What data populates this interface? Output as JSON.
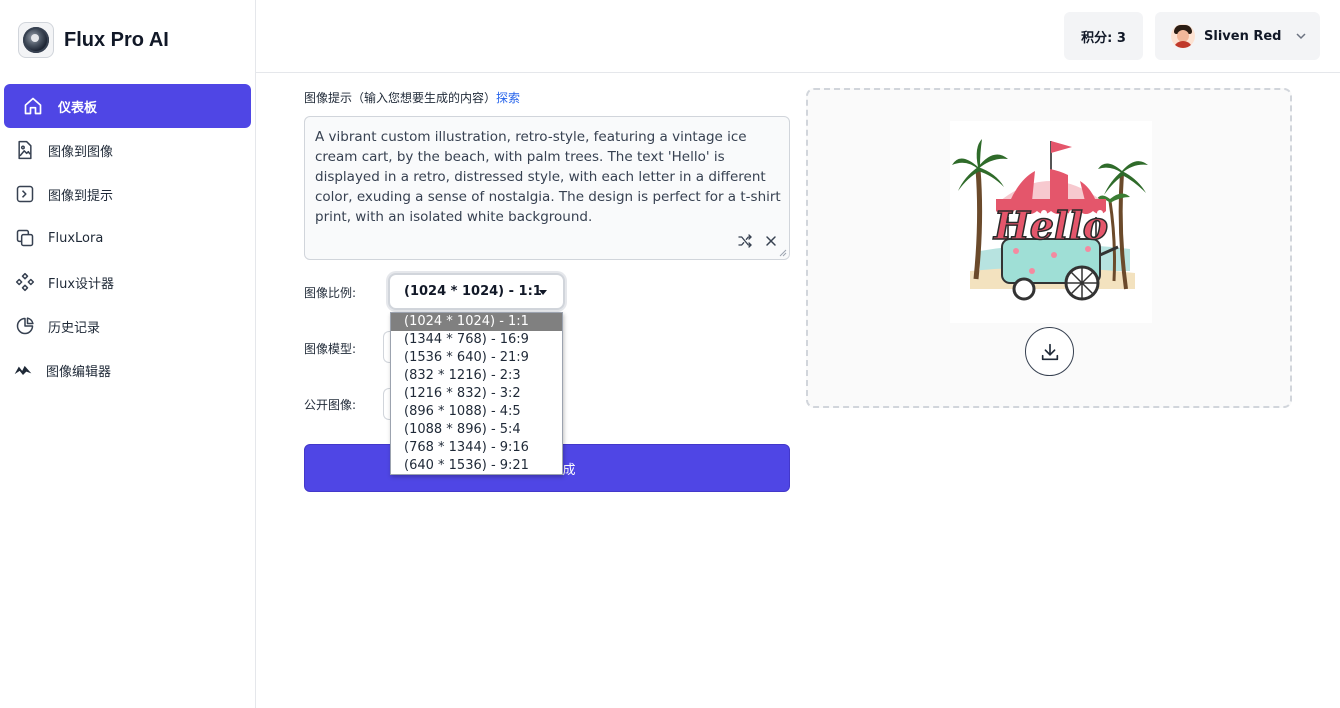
{
  "brand": {
    "name": "Flux Pro AI"
  },
  "sidebar": {
    "items": [
      {
        "label": "仪表板",
        "icon": "home-icon",
        "active": true
      },
      {
        "label": "图像到图像",
        "icon": "image-file-icon"
      },
      {
        "label": "图像到提示",
        "icon": "prompt-chevron-icon"
      },
      {
        "label": "FluxLora",
        "icon": "copy-icon"
      },
      {
        "label": "Flux设计器",
        "icon": "diamond-grid-icon"
      },
      {
        "label": "历史记录",
        "icon": "pie-chart-icon"
      },
      {
        "label": "图像编辑器",
        "icon": "brush-icon"
      }
    ]
  },
  "header": {
    "credits": "积分: 3",
    "user_name": "Sliven Red"
  },
  "form": {
    "prompt_label": "图像提示（输入您想要生成的内容）",
    "explore_link": "探索",
    "prompt_text": "A vibrant custom illustration, retro-style, featuring a vintage ice cream cart, by the beach, with palm trees. The text 'Hello' is displayed in a retro, distressed style, with each letter in a different color, exuding a sense of nostalgia. The design is perfect for a t-shirt print, with an isolated white background.",
    "ratio_label": "图像比例:",
    "ratio_value": "(1024 * 1024) - 1:1",
    "model_label": "图像模型:",
    "public_label": "公开图像:",
    "generate_label_visible": "成",
    "ratio_options": [
      "(1024 * 1024) - 1:1",
      "(1344 * 768) - 16:9",
      "(1536 * 640) - 21:9",
      "(832 * 1216) - 2:3",
      "(1216 * 832) - 3:2",
      "(896 * 1088) - 4:5",
      "(1088 * 896) - 5:4",
      "(768 * 1344) - 9:16",
      "(640 * 1536) - 9:21"
    ]
  },
  "preview": {
    "image_text": "Hello",
    "colors": {
      "accent": "#4f46e5"
    }
  }
}
